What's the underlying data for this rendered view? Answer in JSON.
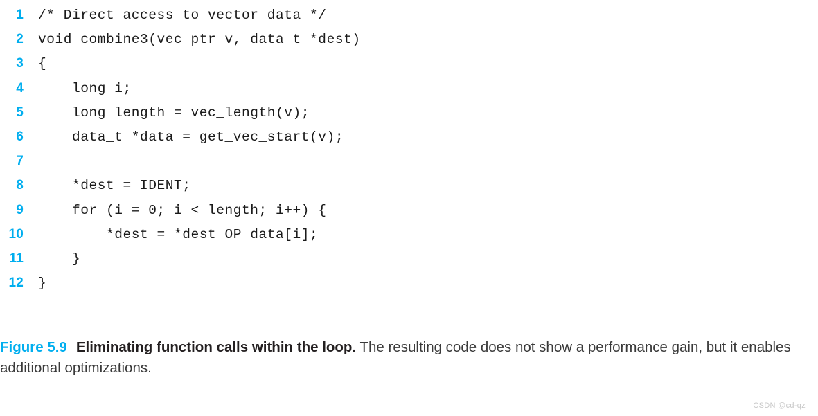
{
  "listing": {
    "lines": [
      {
        "n": "1",
        "code": "/* Direct access to vector data */"
      },
      {
        "n": "2",
        "code": "void combine3(vec_ptr v, data_t *dest)"
      },
      {
        "n": "3",
        "code": "{"
      },
      {
        "n": "4",
        "code": "    long i;"
      },
      {
        "n": "5",
        "code": "    long length = vec_length(v);"
      },
      {
        "n": "6",
        "code": "    data_t *data = get_vec_start(v);"
      },
      {
        "n": "7",
        "code": ""
      },
      {
        "n": "8",
        "code": "    *dest = IDENT;"
      },
      {
        "n": "9",
        "code": "    for (i = 0; i < length; i++) {"
      },
      {
        "n": "10",
        "code": "        *dest = *dest OP data[i];"
      },
      {
        "n": "11",
        "code": "    }"
      },
      {
        "n": "12",
        "code": "}"
      }
    ]
  },
  "caption": {
    "label": "Figure 5.9",
    "title": "Eliminating function calls within the loop.",
    "description": "The resulting code does not show a performance gain, but it enables additional optimizations."
  },
  "watermark": {
    "text": "CSDN @cd-qz"
  },
  "colors": {
    "accent_blue": "#00aeef",
    "code_text": "#1a1a1a",
    "caption_text": "#2b2b2b",
    "watermark": "#c8c8c8",
    "background": "#ffffff"
  }
}
